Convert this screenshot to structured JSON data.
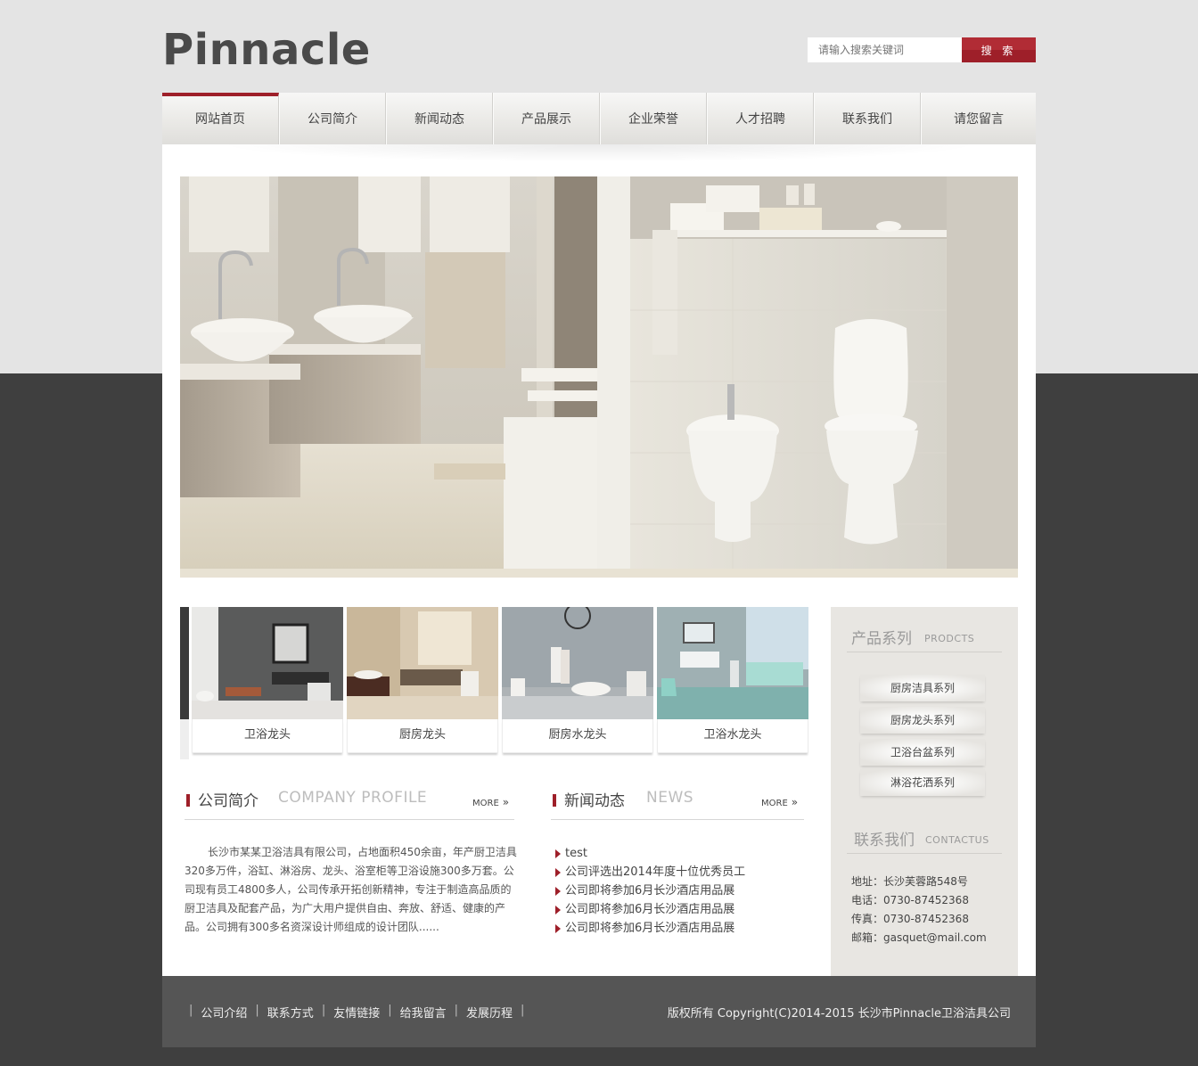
{
  "header": {
    "logo": "Pinnacle",
    "search_placeholder": "请输入搜索关键词",
    "search_button": "搜 索"
  },
  "nav": [
    "网站首页",
    "公司简介",
    "新闻动态",
    "产品展示",
    "企业荣誉",
    "人才招聘",
    "联系我们",
    "请您留言"
  ],
  "thumbs": [
    "卫浴龙头",
    "厨房龙头",
    "厨房水龙头",
    "卫浴水龙头"
  ],
  "profile": {
    "title_cn": "公司简介",
    "title_en": "COMPANY PROFILE",
    "more": "MORE",
    "text": "长沙市某某卫浴洁具有限公司，占地面积450余亩，年产厨卫洁具320多万件，浴缸、淋浴房、龙头、浴室柜等卫浴设施300多万套。公司现有员工4800多人，公司传承开拓创新精神，专注于制造高品质的厨卫洁具及配套产品，为广大用户提供自由、奔放、舒适、健康的产品。公司拥有300多名资深设计师组成的设计团队......"
  },
  "news": {
    "title_cn": "新闻动态",
    "title_en": "NEWS",
    "more": "MORE",
    "items": [
      "test",
      "公司评选出2014年度十位优秀员工",
      "公司即将参加6月长沙酒店用品展",
      "公司即将参加6月长沙酒店用品展",
      "公司即将参加6月长沙酒店用品展"
    ]
  },
  "sidebar": {
    "products_cn": "产品系列",
    "products_en": "PRODCTS",
    "categories": [
      "厨房洁具系列",
      "厨房龙头系列",
      "卫浴台盆系列",
      "淋浴花洒系列"
    ],
    "contact_cn": "联系我们",
    "contact_en": "CONTACTUS",
    "contact": [
      "地址：长沙芙蓉路548号",
      "电话：0730-87452368",
      "传真：0730-87452368",
      "邮箱：gasquet@mail.com"
    ]
  },
  "footer": {
    "links": [
      "公司介绍",
      "联系方式",
      "友情链接",
      "给我留言",
      "发展历程"
    ],
    "copyright": "版权所有 Copyright(C)2014-2015 长沙市Pinnacle卫浴洁具公司"
  },
  "colors": {
    "accent": "#9e1f29",
    "dark_bg": "#3f3f3f",
    "light_bg": "#e4e4e4",
    "footer": "#555555"
  }
}
